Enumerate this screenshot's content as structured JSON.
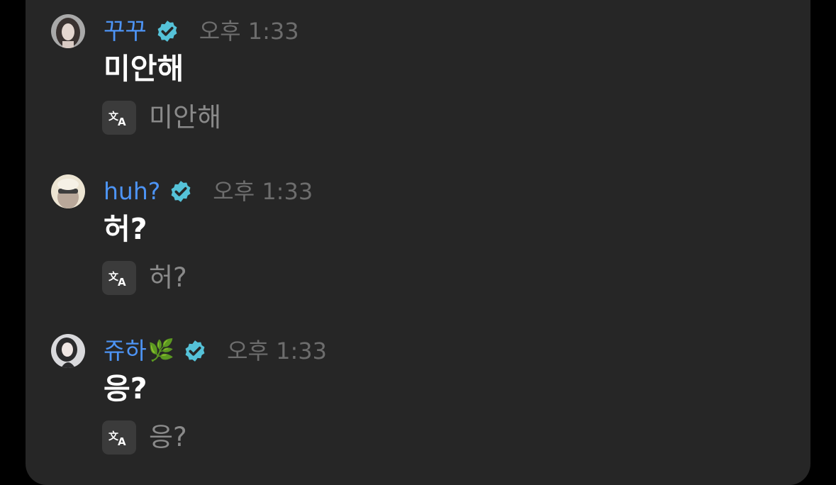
{
  "messages": [
    {
      "author": "꾸꾸",
      "author_emoji": "",
      "verified": true,
      "time": "오후 1:33",
      "text": "미안해",
      "translation": "미안해",
      "avatar_icon": "avatar-woman-dark-hair"
    },
    {
      "author": "huh?",
      "author_emoji": "",
      "verified": true,
      "time": "오후 1:33",
      "text": "허?",
      "translation": "허?",
      "avatar_icon": "avatar-person-with-glasses"
    },
    {
      "author": "쥬하",
      "author_emoji": "🌿",
      "verified": true,
      "time": "오후 1:33",
      "text": "응?",
      "translation": "응?",
      "avatar_icon": "avatar-woman-portrait"
    }
  ],
  "colors": {
    "background": "#000000",
    "panel": "#262626",
    "author_name": "#4d94f5",
    "verified_badge": "#55c2d8",
    "timestamp": "#6d6d6d",
    "message_text": "#ffffff",
    "translation_text": "#8a8a8a",
    "translate_button": "#3b3b3b"
  },
  "icons": {
    "verified": "verified-badge-icon",
    "translate": "translate-icon"
  }
}
